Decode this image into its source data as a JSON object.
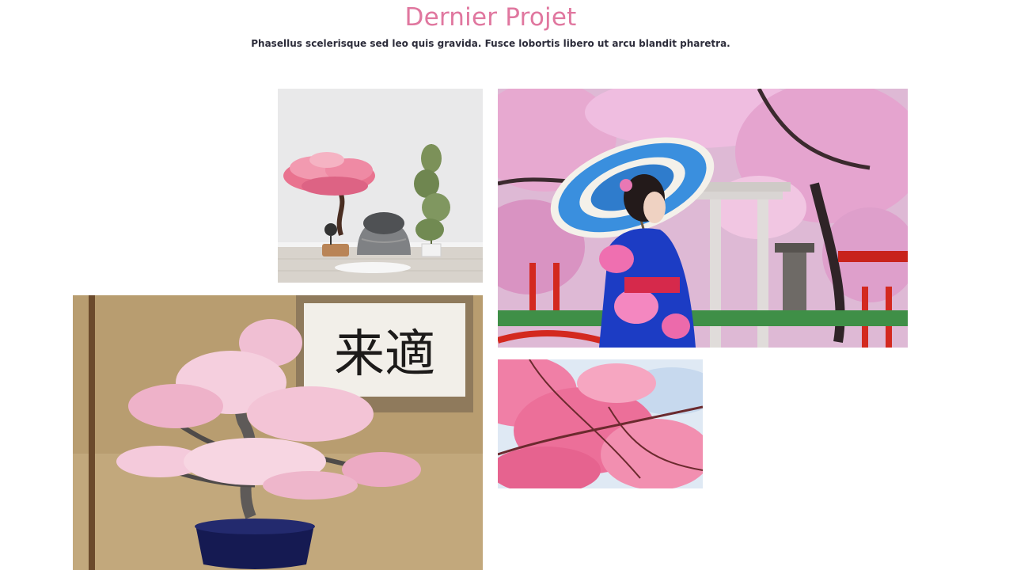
{
  "section": {
    "title": "Dernier Projet",
    "subtitle": "Phasellus scelerisque sed leo quis gravida. Fusce lobortis libero ut arcu blandit pharetra.",
    "title_color": "#e0779f",
    "subtitle_color": "#2c2c3a"
  },
  "gallery": {
    "items": [
      {
        "name": "bonsai-room-photo"
      },
      {
        "name": "kimono-umbrella-photo"
      },
      {
        "name": "bonsai-calligraphy-photo",
        "calligraphy": "来適"
      },
      {
        "name": "cherry-blossom-branches-photo"
      }
    ]
  }
}
